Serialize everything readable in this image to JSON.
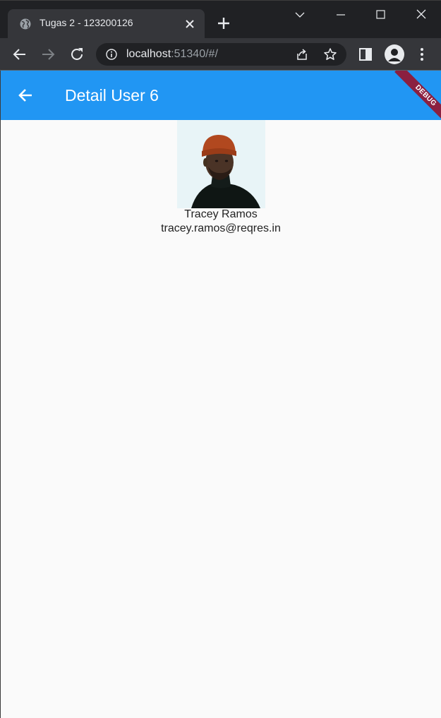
{
  "browser": {
    "tab_title": "Tugas 2 - 123200126",
    "url_host": "localhost",
    "url_path": ":51340/#/",
    "icons": [
      "globe-icon",
      "close-icon",
      "plus-icon",
      "chevron-down-icon",
      "minimize-icon",
      "maximize-icon",
      "window-close-icon",
      "back-icon",
      "forward-icon",
      "reload-icon",
      "info-icon",
      "share-icon",
      "star-icon",
      "side-panel-icon",
      "profile-icon",
      "more-vert-icon"
    ]
  },
  "app": {
    "title": "Detail User 6",
    "debug_label": "DEBUG",
    "colors": {
      "appbar": "#2196f3",
      "debug_ribbon": "#8b2040",
      "background": "#fafafa"
    }
  },
  "user": {
    "name": "Tracey Ramos",
    "email": "tracey.ramos@reqres.in"
  }
}
